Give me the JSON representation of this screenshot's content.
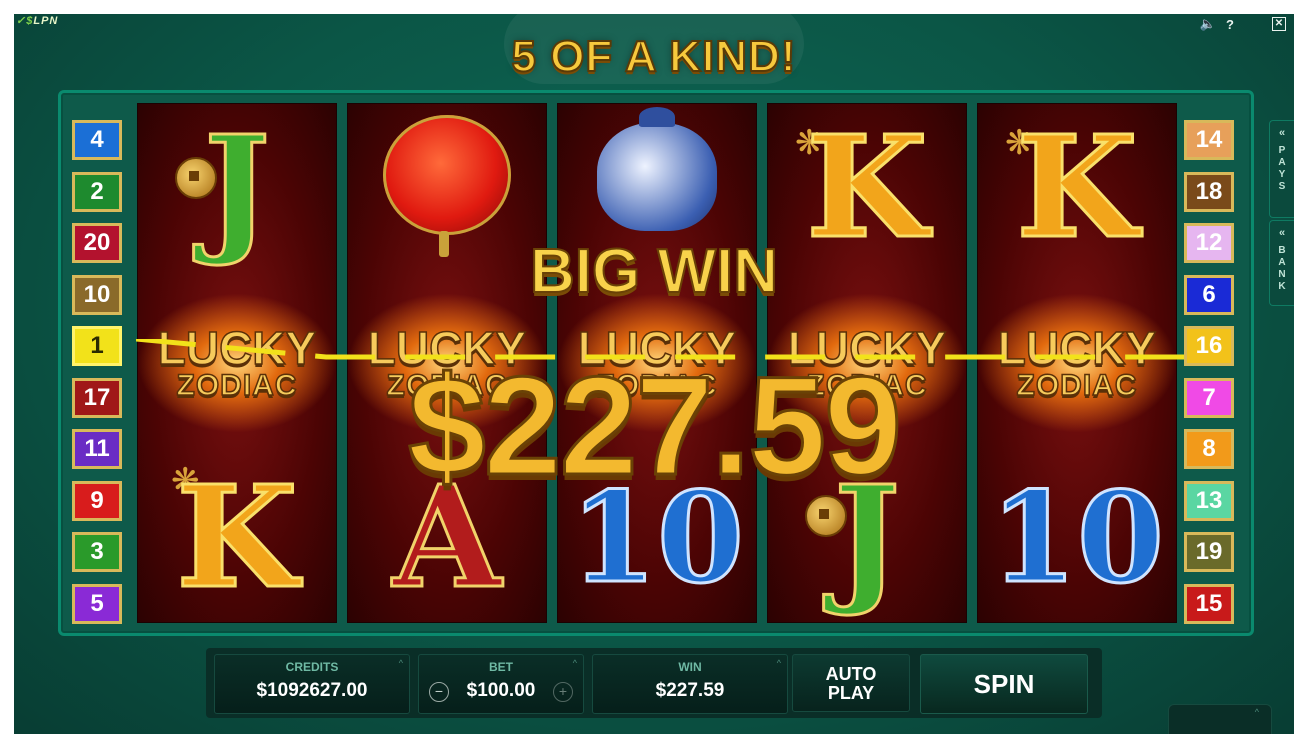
{
  "brand": {
    "text": "LPN",
    "prefix": "✓$"
  },
  "top": {
    "sound_icon": "speaker-icon",
    "help": "?",
    "close": "✕"
  },
  "headline": "5 OF A KIND!",
  "big_win": {
    "title": "BIG WIN",
    "amount": "$227.59"
  },
  "logo": {
    "line1": "LUCKY",
    "line2": "ZODIAC"
  },
  "reels": [
    {
      "top": "J",
      "bottom": "K"
    },
    {
      "top": "lantern",
      "bottom": "A"
    },
    {
      "top": "vase",
      "bottom": "10"
    },
    {
      "top": "K",
      "bottom": "J"
    },
    {
      "top": "K",
      "bottom": "10"
    }
  ],
  "paylines_left": [
    {
      "num": "4",
      "color": "#1b6fd6"
    },
    {
      "num": "2",
      "color": "#1e8a2e"
    },
    {
      "num": "20",
      "color": "#b3122e"
    },
    {
      "num": "10",
      "color": "#8a6a2a"
    },
    {
      "num": "1",
      "color": "#f2e21a",
      "active": true
    },
    {
      "num": "17",
      "color": "#a01818"
    },
    {
      "num": "11",
      "color": "#6a2cc4"
    },
    {
      "num": "9",
      "color": "#d81c1c"
    },
    {
      "num": "3",
      "color": "#2a9a2a"
    },
    {
      "num": "5",
      "color": "#8a2ad6"
    }
  ],
  "paylines_right": [
    {
      "num": "14",
      "color": "#e7a05a"
    },
    {
      "num": "18",
      "color": "#7a4a1a"
    },
    {
      "num": "12",
      "color": "#e6b6f0"
    },
    {
      "num": "6",
      "color": "#1a2ad6"
    },
    {
      "num": "16",
      "color": "#f2c21a"
    },
    {
      "num": "7",
      "color": "#f04ae6"
    },
    {
      "num": "8",
      "color": "#f29a1a"
    },
    {
      "num": "13",
      "color": "#5ad6a2"
    },
    {
      "num": "19",
      "color": "#6a6a2a"
    },
    {
      "num": "15",
      "color": "#c81a1a"
    }
  ],
  "side_tabs": {
    "pays": "PAYS",
    "bank": "BANK",
    "chevron": "«"
  },
  "controls": {
    "credits_label": "CREDITS",
    "credits_value": "$1092627.00",
    "bet_label": "BET",
    "bet_value": "$100.00",
    "bet_minus": "−",
    "bet_plus": "+",
    "win_label": "WIN",
    "win_value": "$227.59",
    "autoplay_line1": "AUTO",
    "autoplay_line2": "PLAY",
    "spin_label": "SPIN",
    "caret": "^"
  }
}
